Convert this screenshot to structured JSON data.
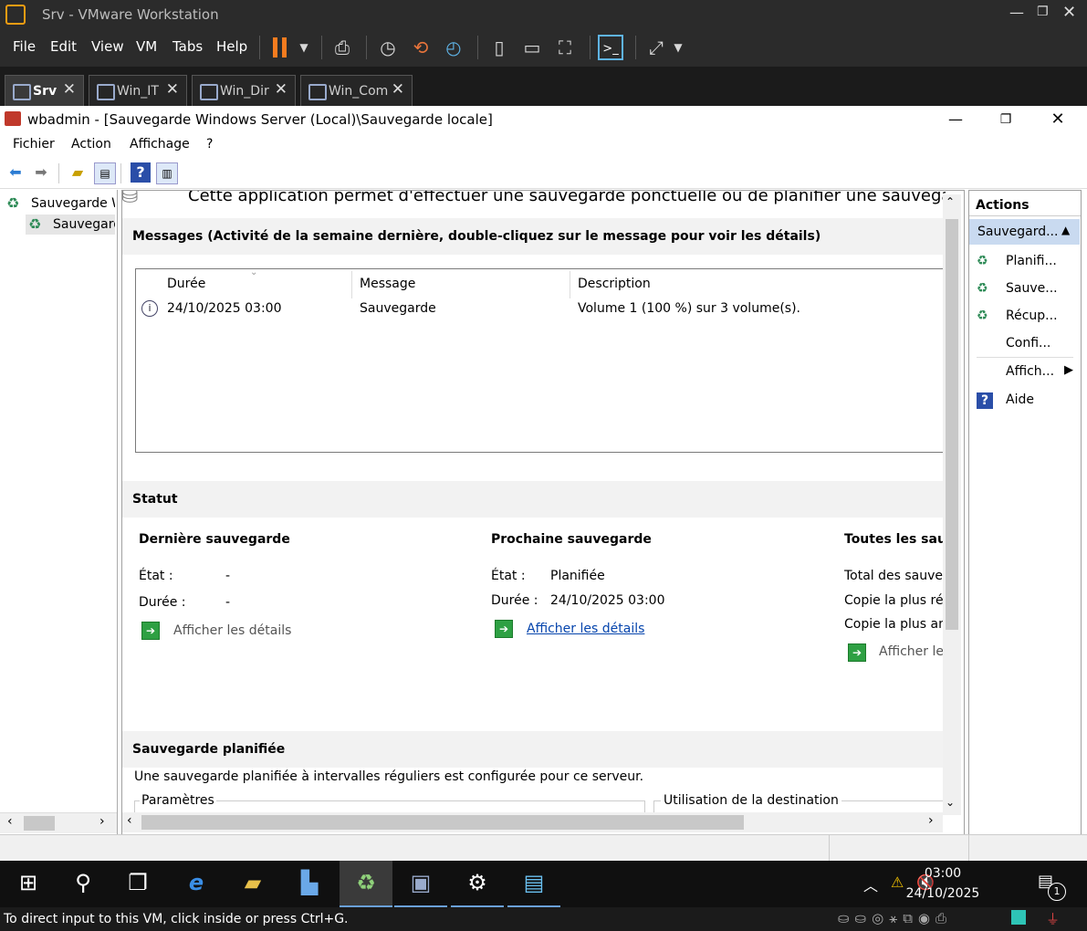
{
  "vmware": {
    "window_title": "Srv - VMware Workstation",
    "menus": [
      "File",
      "Edit",
      "View",
      "VM",
      "Tabs",
      "Help"
    ],
    "tabs": [
      {
        "label": "Srv",
        "active": true
      },
      {
        "label": "Win_IT",
        "active": false
      },
      {
        "label": "Win_Dir",
        "active": false
      },
      {
        "label": "Win_Com",
        "active": false
      }
    ],
    "status_message": "To direct input to this VM, click inside or press Ctrl+G."
  },
  "guest_window": {
    "title": "wbadmin - [Sauvegarde Windows Server (Local)\\Sauvegarde locale]",
    "menus": [
      "Fichier",
      "Action",
      "Affichage",
      "?"
    ]
  },
  "tree": {
    "items": [
      {
        "label": "Sauvegarde Windows Server (Local)"
      },
      {
        "label": "Sauvegarde locale"
      }
    ]
  },
  "center": {
    "intro_text": "Cette application permet d'effectuer une sauvegarde ponctuelle ou de planifier une sauvegarde",
    "messages_heading": "Messages (Activité de la semaine dernière, double-cliquez sur le message pour voir les détails)",
    "table": {
      "columns": [
        "Durée",
        "Message",
        "Description"
      ],
      "rows": [
        {
          "duree": "24/10/2025 03:00",
          "message": "Sauvegarde",
          "description": "Volume 1 (100 %) sur 3 volume(s)."
        }
      ]
    },
    "status_heading": "Statut",
    "last_backup": {
      "title": "Dernière sauvegarde",
      "etat_label": "État :",
      "etat_value": "-",
      "duree_label": "Durée :",
      "duree_value": "-",
      "details": "Afficher les détails"
    },
    "next_backup": {
      "title": "Prochaine sauvegarde",
      "etat_label": "État :",
      "etat_value": "Planifiée",
      "duree_label": "Durée :",
      "duree_value": "24/10/2025 03:00",
      "details": "Afficher les détails"
    },
    "all_backups": {
      "title": "Toutes les sauvegardes",
      "line1": "Total des sauvegardes",
      "line2": "Copie la plus récente",
      "line3": "Copie la plus ancienne",
      "details": "Afficher les détails"
    },
    "scheduled_heading": "Sauvegarde planifiée",
    "scheduled_text": "Une sauvegarde planifiée à intervalles réguliers est configurée pour ce serveur.",
    "params_label": "Paramètres",
    "dest_label": "Utilisation de la destination"
  },
  "actions": {
    "header": "Actions",
    "group": "Sauvegard...",
    "items": [
      "Planifi...",
      "Sauve...",
      "Récup...",
      "Confi...",
      "Affich...",
      "Aide"
    ]
  },
  "taskbar": {
    "time": "03:00",
    "date": "24/10/2025",
    "notification_count": "1"
  }
}
